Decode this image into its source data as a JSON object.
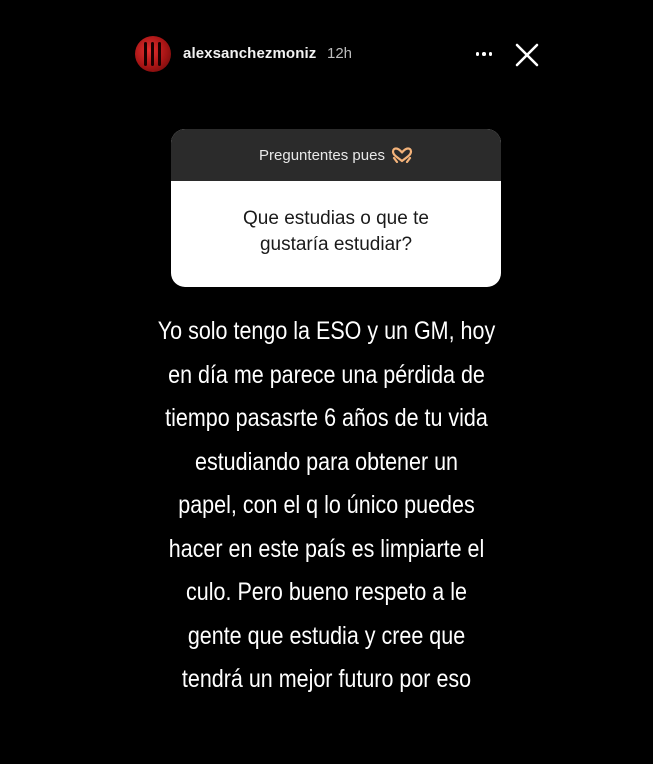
{
  "header": {
    "username": "alexsanchezmoniz",
    "timestamp": "12h"
  },
  "icons": {
    "more": "more-horizontal-icon",
    "close": "close-icon",
    "hands": "heart-hands-emoji"
  },
  "question_sticker": {
    "prompt": "Preguntentes pues",
    "question_lines": [
      "Que estudias o que te",
      "gustaría estudiar?"
    ]
  },
  "answer": {
    "lines": [
      "Yo solo tengo la ESO y un GM, hoy",
      "en día me parece una pérdida de",
      "tiempo pasasrte 6 años de tu vida",
      "estudiando para obtener un",
      "papel, con el q lo único puedes",
      "hacer en este país es limpiarte el",
      "culo. Pero bueno respeto a le",
      "gente que estudia y cree que",
      "tendrá un mejor futuro por eso"
    ]
  },
  "colors": {
    "background": "#000000",
    "sticker_header": "#2b2b2b",
    "sticker_body": "#ffffff",
    "avatar_red": "#c41e1e"
  }
}
